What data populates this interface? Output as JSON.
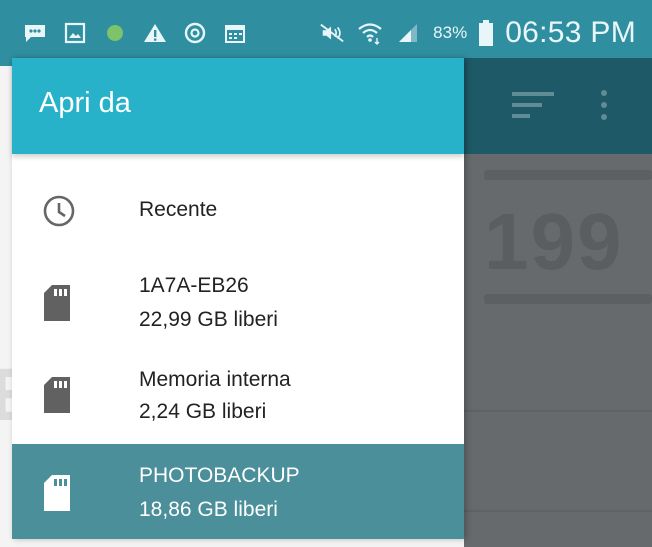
{
  "status_bar": {
    "battery_percent": "83%",
    "time": "06:53 PM",
    "icons": [
      "message-icon",
      "gallery-icon",
      "green-dot-icon",
      "warning-icon",
      "sync-icon",
      "calendar-icon",
      "mute-icon",
      "wifi-icon",
      "signal-icon",
      "battery-icon"
    ]
  },
  "drawer": {
    "title": "Apri da",
    "items": [
      {
        "label": "Recente",
        "icon": "clock-icon",
        "selected": false
      },
      {
        "label": "1A7A-EB26",
        "sublabel": "22,99 GB liberi",
        "icon": "sd-card-icon",
        "selected": false
      },
      {
        "label": "Memoria interna",
        "sublabel": "2,24 GB liberi",
        "icon": "sd-card-icon",
        "selected": false
      },
      {
        "label": "PHOTOBACKUP",
        "sublabel": "18,86 GB liberi",
        "icon": "sd-card-icon",
        "selected": true
      }
    ]
  },
  "background_app": {
    "headline": "199",
    "toolbar_icons": [
      "sort-icon",
      "more-vert-icon"
    ]
  },
  "colors": {
    "status_bar": "#2f8fa0",
    "drawer_header": "#28b2c9",
    "selected_item": "#4a8f9a",
    "app_toolbar": "#1d5966",
    "app_content": "#666a6c"
  }
}
